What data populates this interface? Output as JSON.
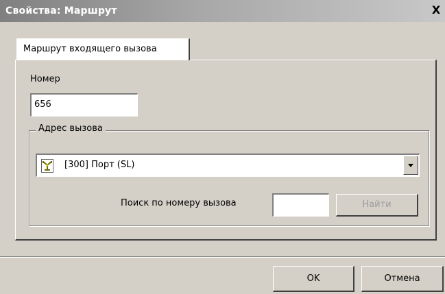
{
  "window": {
    "title": "Свойства: Маршрут",
    "close_label": "X"
  },
  "tabs": [
    {
      "label": "Маршрут входящего вызова",
      "active": true
    }
  ],
  "form": {
    "number_label": "Номер",
    "number_value": "656",
    "address_group_label": "Адрес вызова",
    "address_value": "[300] Порт (SL)",
    "address_icon": "port-icon",
    "search_label": "Поиск по номеру вызова",
    "search_value": "",
    "find_button_label": "Найти",
    "find_button_enabled": false
  },
  "footer": {
    "ok_label": "OK",
    "cancel_label": "Отмена"
  },
  "colors": {
    "window_bg": "#d4d0c8",
    "title_text": "#ffffff",
    "disabled_text": "#9b9b9b"
  }
}
